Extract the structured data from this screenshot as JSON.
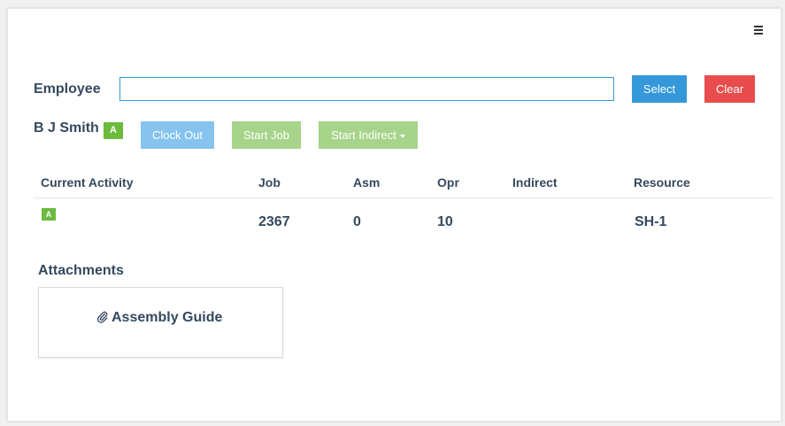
{
  "header": {
    "menu_icon": "hamburger-menu-icon"
  },
  "employee": {
    "label": "Employee",
    "input_value": "",
    "select_label": "Select",
    "clear_label": "Clear"
  },
  "current_employee": {
    "name": "B J Smith",
    "status_badge": "A"
  },
  "actions": {
    "clock_out": "Clock Out",
    "start_job": "Start Job",
    "start_indirect": "Start Indirect"
  },
  "activity_table": {
    "headers": [
      "Current Activity",
      "Job",
      "Asm",
      "Opr",
      "Indirect",
      "Resource"
    ],
    "rows": [
      {
        "status_badge": "A",
        "job": "2367",
        "asm": "0",
        "opr": "10",
        "indirect": "",
        "resource": "SH-1"
      }
    ]
  },
  "attachments": {
    "label": "Attachments",
    "items": [
      {
        "icon": "paperclip-icon",
        "title": "Assembly Guide"
      }
    ]
  },
  "colors": {
    "primary_blue": "#3498db",
    "danger_red": "#e84c4c",
    "light_blue": "#86c3ee",
    "light_green": "#a6d48a",
    "badge_green": "#6cba3e",
    "text": "#34495e"
  }
}
